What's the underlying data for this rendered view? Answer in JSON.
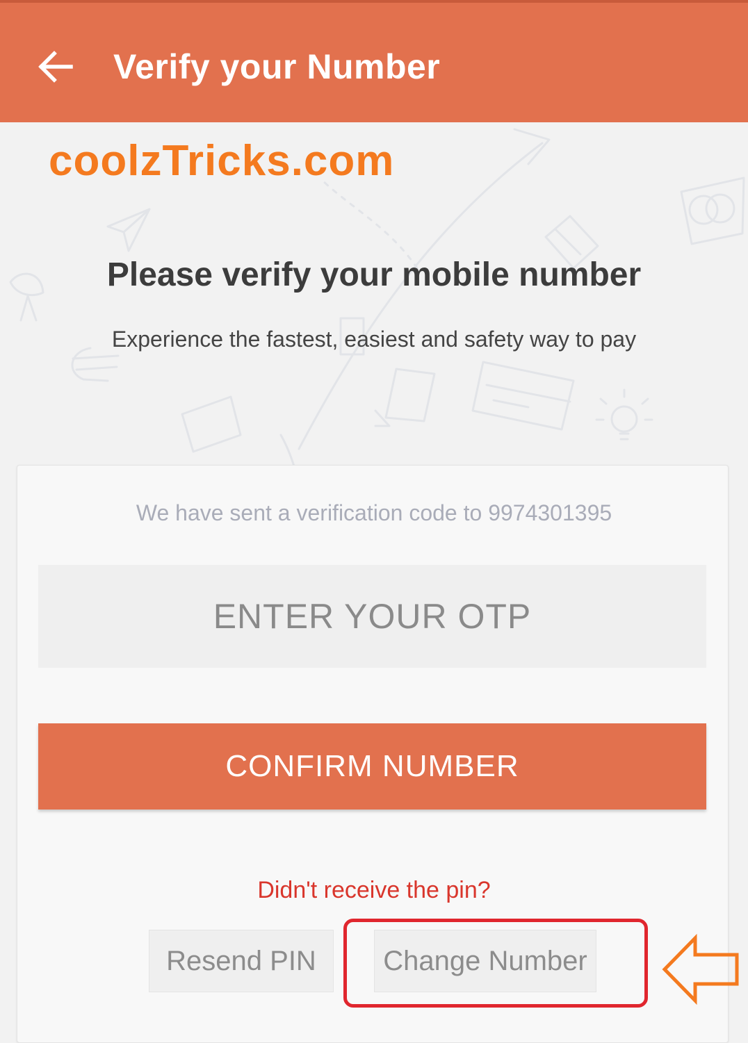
{
  "header": {
    "title": "Verify your Number",
    "background_color": "#e2714e",
    "back_icon": "arrow-left-icon"
  },
  "watermark": {
    "text": "coolzTricks.com",
    "color": "#f47a1f"
  },
  "intro": {
    "heading": "Please verify your mobile number",
    "subheading": "Experience the fastest, easiest and safety way to pay"
  },
  "verification": {
    "sent_text": "We have sent a verification code to 9974301395",
    "otp_placeholder": "ENTER YOUR OTP",
    "otp_value": "",
    "confirm_label": "CONFIRM NUMBER",
    "resend_prompt": "Didn't receive the pin?",
    "resend_label": "Resend PIN",
    "change_label": "Change Number"
  },
  "annotations": {
    "highlight_color": "#e0262e",
    "arrow_color": "#f47a1f",
    "arrow_icon": "arrow-left-outline-icon"
  },
  "colors": {
    "accent": "#e2714e",
    "error_text": "#d9362c",
    "page_background": "#f2f2f2"
  }
}
